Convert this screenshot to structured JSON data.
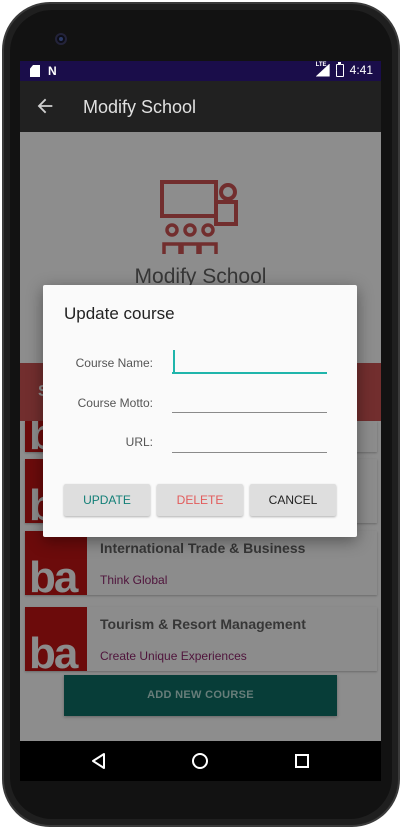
{
  "status_bar": {
    "time": "4:41",
    "lte_label": "LTE",
    "icons": [
      "sd-card-icon",
      "n-notification-icon",
      "lte-signal-icon",
      "battery-charging-icon"
    ]
  },
  "app_bar": {
    "back_icon": "arrow-left-icon",
    "title": "Modify School"
  },
  "content": {
    "hero_icon": "teacher-classroom-icon",
    "hero_title": "Modify School",
    "band_text": "S",
    "courses": [
      {
        "logo": "ba",
        "title": "",
        "subtitle": ""
      },
      {
        "logo": "ba",
        "title": "",
        "subtitle": ""
      },
      {
        "logo": "ba",
        "title": "International Trade & Business",
        "subtitle": "Think Global"
      },
      {
        "logo": "ba",
        "title": "Tourism & Resort Management",
        "subtitle": "Create Unique Experiences"
      }
    ],
    "add_button": "ADD NEW COURSE"
  },
  "dialog": {
    "title": "Update course",
    "fields": [
      {
        "label": "Course Name:",
        "value": "",
        "placeholder": ""
      },
      {
        "label": "Course Motto:",
        "value": "",
        "placeholder": ""
      },
      {
        "label": "URL:",
        "value": "",
        "placeholder": ""
      }
    ],
    "buttons": {
      "update": "UPDATE",
      "delete": "DELETE",
      "cancel": "CANCEL"
    }
  },
  "colors": {
    "accent": "#1fb5ab",
    "update_text": "#127f77",
    "delete_text": "#e25b5b",
    "cancel_text": "#222222",
    "status_bar": "#1a0d4a",
    "course_logo": "#a61212",
    "course_subtitle": "#7a1f5c",
    "add_button": "#0b5e57"
  },
  "nav_bar": {
    "icons": [
      "nav-back-icon",
      "nav-home-icon",
      "nav-recents-icon"
    ]
  }
}
